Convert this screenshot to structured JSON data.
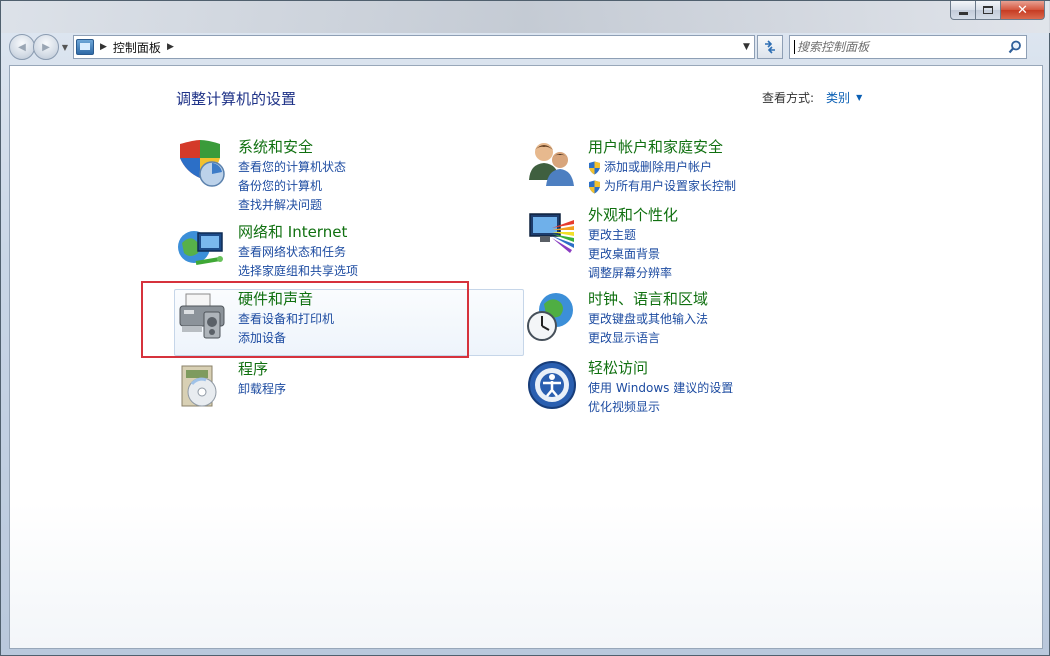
{
  "window": {
    "minimize_label": "",
    "maximize_label": "",
    "close_label": "✕"
  },
  "nav": {
    "back_label": "◀",
    "forward_label": "▶",
    "breadcrumb": "控制面板",
    "search_placeholder": "搜索控制面板"
  },
  "header": {
    "title": "调整计算机的设置",
    "view_label": "查看方式:",
    "view_value": "类别"
  },
  "categories": {
    "system": {
      "title": "系统和安全",
      "links": [
        "查看您的计算机状态",
        "备份您的计算机",
        "查找并解决问题"
      ]
    },
    "network": {
      "title": "网络和 Internet",
      "links": [
        "查看网络状态和任务",
        "选择家庭组和共享选项"
      ]
    },
    "hardware": {
      "title": "硬件和声音",
      "links": [
        "查看设备和打印机",
        "添加设备"
      ]
    },
    "programs": {
      "title": "程序",
      "links": [
        "卸载程序"
      ]
    },
    "users": {
      "title": "用户帐户和家庭安全",
      "links": [
        "添加或删除用户帐户",
        "为所有用户设置家长控制"
      ]
    },
    "appearance": {
      "title": "外观和个性化",
      "links": [
        "更改主题",
        "更改桌面背景",
        "调整屏幕分辨率"
      ]
    },
    "clock": {
      "title": "时钟、语言和区域",
      "links": [
        "更改键盘或其他输入法",
        "更改显示语言"
      ]
    },
    "ease": {
      "title": "轻松访问",
      "links": [
        "使用 Windows 建议的设置",
        "优化视频显示"
      ]
    }
  },
  "colors": {
    "title_blue": "#1e3287",
    "category_green": "#107010",
    "link_blue": "#1e4ca1",
    "highlight_red": "#d6323c"
  }
}
